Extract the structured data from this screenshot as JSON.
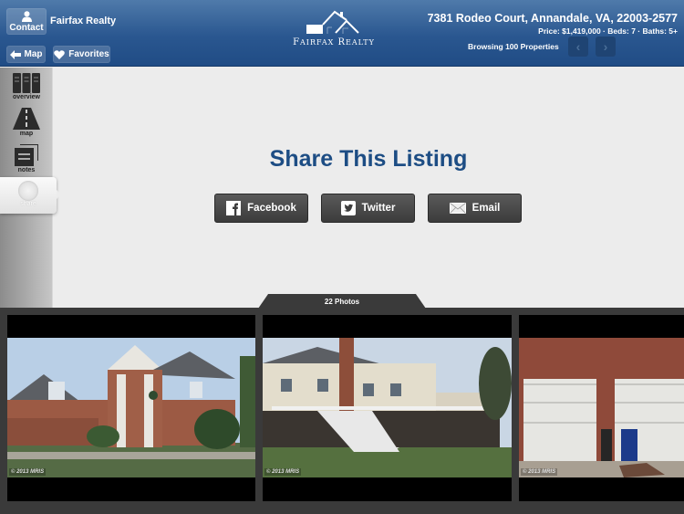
{
  "header": {
    "contact_label": "Contact",
    "agency_name": "Fairfax Realty",
    "map_label": "Map",
    "favorites_label": "Favorites",
    "logo_text_first": "F",
    "logo_text_first_rest": "AIRFAX",
    "logo_text_second": "R",
    "logo_text_second_rest": "EALTY",
    "address": "7381 Rodeo Court, Annandale, VA, 22003-2577",
    "details": "Price: $1,419,000 · Beds: 7 · Baths: 5+",
    "browsing": "Browsing 100 Properties",
    "prev_glyph": "‹",
    "next_glyph": "›"
  },
  "sidebar": {
    "items": [
      {
        "label": "overview",
        "icon": "overview-icon"
      },
      {
        "label": "map",
        "icon": "road-icon"
      },
      {
        "label": "notes",
        "icon": "notes-icon"
      },
      {
        "label": "share",
        "icon": "share-icon",
        "selected": true
      }
    ]
  },
  "main": {
    "title": "Share This Listing",
    "buttons": [
      {
        "label": "Facebook",
        "icon": "facebook-icon"
      },
      {
        "label": "Twitter",
        "icon": "twitter-icon"
      },
      {
        "label": "Email",
        "icon": "email-icon"
      }
    ]
  },
  "photos": {
    "count_label": "22 Photos",
    "items": [
      {
        "copyright": "© 2013 MRIS"
      },
      {
        "copyright": "© 2013 MRIS"
      },
      {
        "copyright": "© 2013 MRIS"
      }
    ]
  },
  "colors": {
    "header_blue": "#2a5790",
    "title_blue": "#1d4d84",
    "button_dark": "#4a4a4a",
    "strip_gray": "#3a3a3a"
  }
}
